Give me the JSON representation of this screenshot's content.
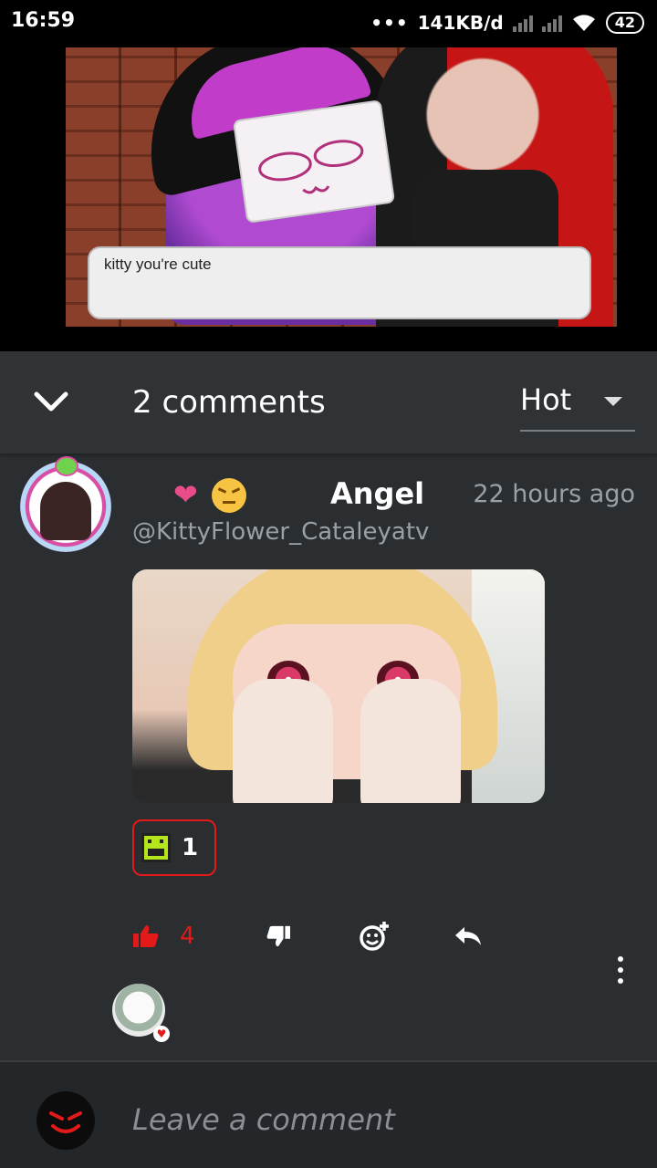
{
  "status_bar": {
    "time": "16:59",
    "dots": "•••",
    "network_speed": "141KB/d",
    "battery": "42",
    "icons": [
      "signal-icon",
      "signal-off-icon",
      "wifi-icon",
      "battery-icon"
    ]
  },
  "video": {
    "dialog_text": "kitty you're cute"
  },
  "comments_header": {
    "count_label": "2 comments",
    "sort_label": "Hot"
  },
  "comment": {
    "emoji_badges": [
      "❤",
      "😣"
    ],
    "author": "Angel",
    "time": "22 hours ago",
    "handle": "@KittyFlower_Cataleyatv",
    "reaction_count": "1",
    "like_count": "4"
  },
  "composer": {
    "placeholder": "Leave a comment"
  },
  "colors": {
    "accent_red": "#e31a1a",
    "background": "#2a2e31",
    "muted_text": "#9ba0a5"
  }
}
